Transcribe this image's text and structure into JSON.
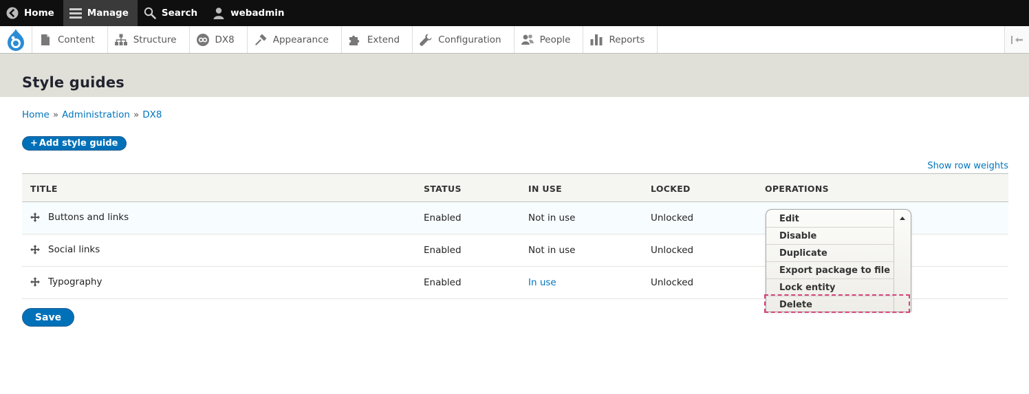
{
  "toolbar": {
    "home": "Home",
    "manage": "Manage",
    "search": "Search",
    "user": "webadmin"
  },
  "tray": {
    "items": [
      {
        "label": "Content",
        "icon": "document-icon"
      },
      {
        "label": "Structure",
        "icon": "structure-icon"
      },
      {
        "label": "DX8",
        "icon": "dx8-icon"
      },
      {
        "label": "Appearance",
        "icon": "paintbrush-icon"
      },
      {
        "label": "Extend",
        "icon": "puzzle-icon"
      },
      {
        "label": "Configuration",
        "icon": "wrench-icon"
      },
      {
        "label": "People",
        "icon": "people-icon"
      },
      {
        "label": "Reports",
        "icon": "bar-chart-icon"
      }
    ]
  },
  "page": {
    "title": "Style guides"
  },
  "breadcrumb": [
    "Home",
    "Administration",
    "DX8"
  ],
  "actions": {
    "add": "Add style guide",
    "add_prefix": "+",
    "show_weights": "Show row weights",
    "save": "Save"
  },
  "table": {
    "headers": [
      "TITLE",
      "STATUS",
      "IN USE",
      "LOCKED",
      "OPERATIONS"
    ],
    "rows": [
      {
        "title": "Buttons and links",
        "status": "Enabled",
        "in_use": "Not in use",
        "locked": "Unlocked"
      },
      {
        "title": "Social links",
        "status": "Enabled",
        "in_use": "Not in use",
        "locked": "Unlocked"
      },
      {
        "title": "Typography",
        "status": "Enabled",
        "in_use": "In use",
        "locked": "Unlocked"
      }
    ]
  },
  "operations": [
    "Edit",
    "Disable",
    "Duplicate",
    "Export package to file",
    "Lock entity",
    "Delete"
  ],
  "colors": {
    "toolbar_bg": "#0f0f0f",
    "link": "#0074bd",
    "button_primary": "#0071b8",
    "header_bg": "#e0e0d8",
    "highlight_outline": "#d4427a"
  }
}
